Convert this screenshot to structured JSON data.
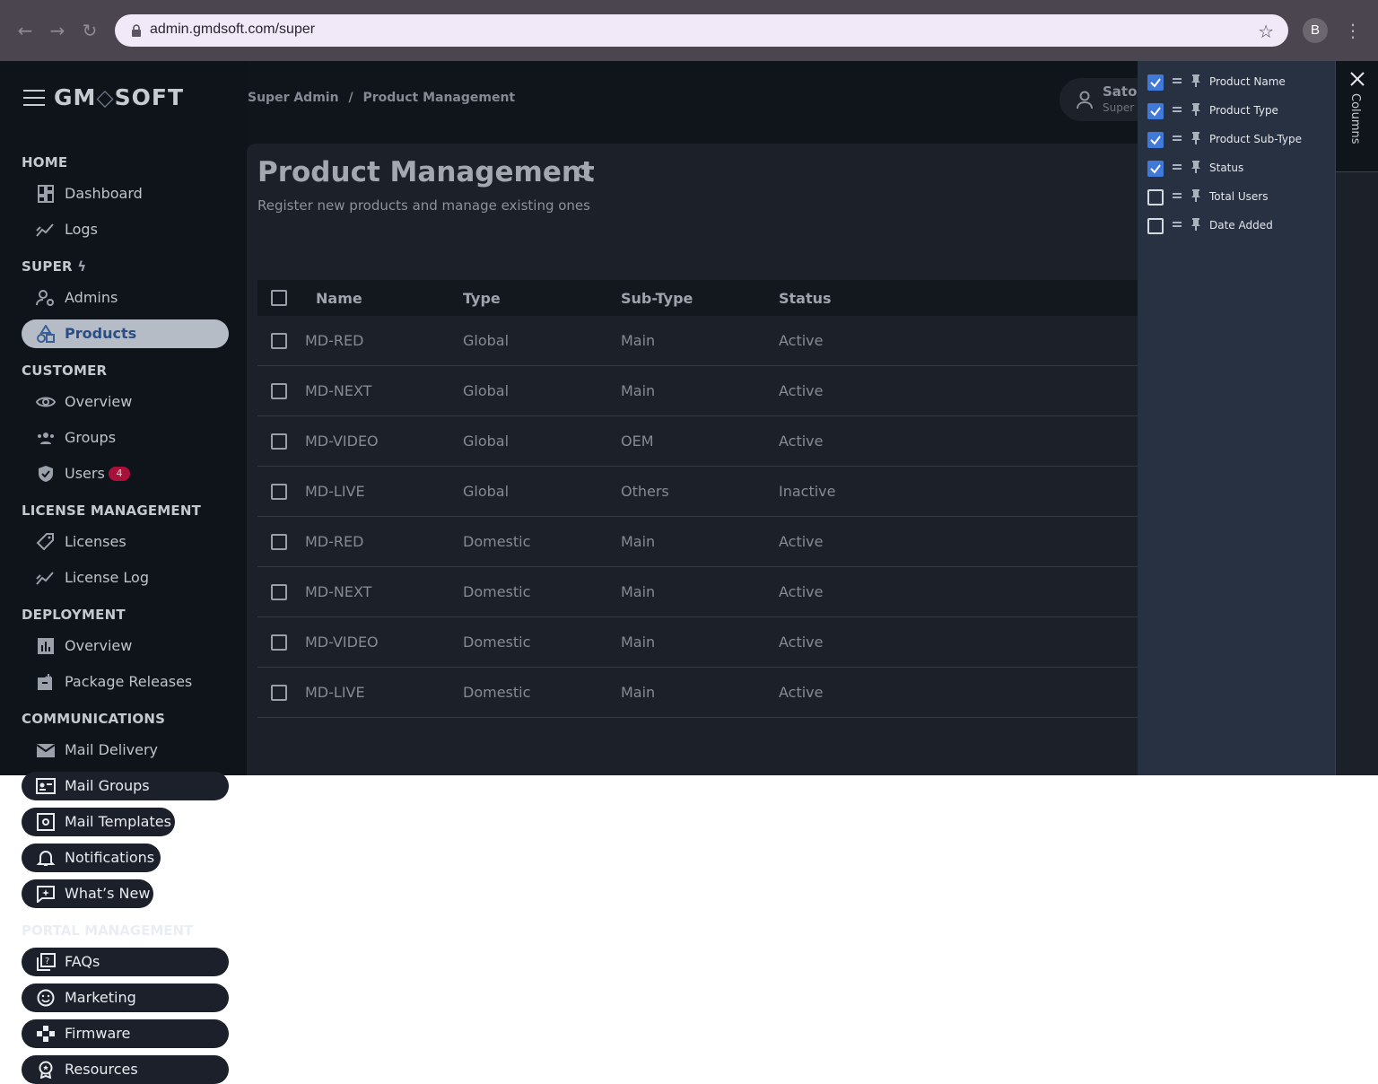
{
  "browser": {
    "url": "admin.gmdsoft.com/super",
    "profile_initial": "B"
  },
  "app": {
    "brand": "GMDSOFT",
    "breadcrumb": [
      "Super Admin",
      "/",
      "Product Management"
    ],
    "user": {
      "name": "Sator",
      "role": "Super A"
    }
  },
  "sidebar": {
    "sections": [
      {
        "title": "HOME",
        "items": [
          {
            "label": "Dashboard",
            "icon": "dashboard-icon"
          },
          {
            "label": "Logs",
            "icon": "chart-line-icon"
          }
        ]
      },
      {
        "title": "SUPER",
        "title_icon": "bolt-icon",
        "items": [
          {
            "label": "Admins",
            "icon": "admin-user-icon"
          },
          {
            "label": "Products",
            "icon": "shapes-icon",
            "active": true
          }
        ]
      },
      {
        "title": "CUSTOMER",
        "items": [
          {
            "label": "Overview",
            "icon": "eye-icon"
          },
          {
            "label": "Groups",
            "icon": "groups-icon"
          },
          {
            "label": "Users",
            "icon": "shield-check-icon",
            "badge": "4"
          }
        ]
      },
      {
        "title": "LICENSE MANAGEMENT",
        "items": [
          {
            "label": "Licenses",
            "icon": "key-tag-icon"
          },
          {
            "label": "License Log",
            "icon": "chart-line-icon"
          }
        ]
      },
      {
        "title": "DEPLOYMENT",
        "items": [
          {
            "label": "Overview",
            "icon": "bar-chart-icon"
          },
          {
            "label": "Package Releases",
            "icon": "package-download-icon"
          }
        ]
      },
      {
        "title": "COMMUNICATIONS",
        "items": [
          {
            "label": "Mail Delivery",
            "icon": "mail-icon"
          },
          {
            "label": "Mail Groups",
            "icon": "contact-card-icon"
          },
          {
            "label": "Mail Templates",
            "icon": "template-gear-icon"
          },
          {
            "label": "Notifications",
            "icon": "bell-icon"
          },
          {
            "label": "What’s New",
            "icon": "sparkle-chat-icon"
          }
        ]
      },
      {
        "title": "PORTAL MANAGEMENT",
        "items": [
          {
            "label": "FAQs",
            "icon": "faq-icon"
          },
          {
            "label": "Marketing",
            "icon": "smile-icon"
          },
          {
            "label": "Firmware",
            "icon": "gamepad-icon"
          },
          {
            "label": "Resources",
            "icon": "award-icon"
          }
        ]
      }
    ]
  },
  "page": {
    "title": "Product Management",
    "subtitle": "Register new products and manage existing ones"
  },
  "table": {
    "columns": [
      "Name",
      "Type",
      "Sub-Type",
      "Status"
    ],
    "rows": [
      [
        "MD-RED",
        "Global",
        "Main",
        "Active"
      ],
      [
        "MD-NEXT",
        "Global",
        "Main",
        "Active"
      ],
      [
        "MD-VIDEO",
        "Global",
        "OEM",
        "Active"
      ],
      [
        "MD-LIVE",
        "Global",
        "Others",
        "Inactive"
      ],
      [
        "MD-RED",
        "Domestic",
        "Main",
        "Active"
      ],
      [
        "MD-NEXT",
        "Domestic",
        "Main",
        "Active"
      ],
      [
        "MD-VIDEO",
        "Domestic",
        "Main",
        "Active"
      ],
      [
        "MD-LIVE",
        "Domestic",
        "Main",
        "Active"
      ]
    ]
  },
  "columns_panel": {
    "tab_label": "Columns",
    "items": [
      {
        "label": "Product Name",
        "checked": true
      },
      {
        "label": "Product Type",
        "checked": true
      },
      {
        "label": "Product Sub-Type",
        "checked": true
      },
      {
        "label": "Status",
        "checked": true
      },
      {
        "label": "Total Users",
        "checked": false
      },
      {
        "label": "Date Added",
        "checked": false
      }
    ]
  }
}
